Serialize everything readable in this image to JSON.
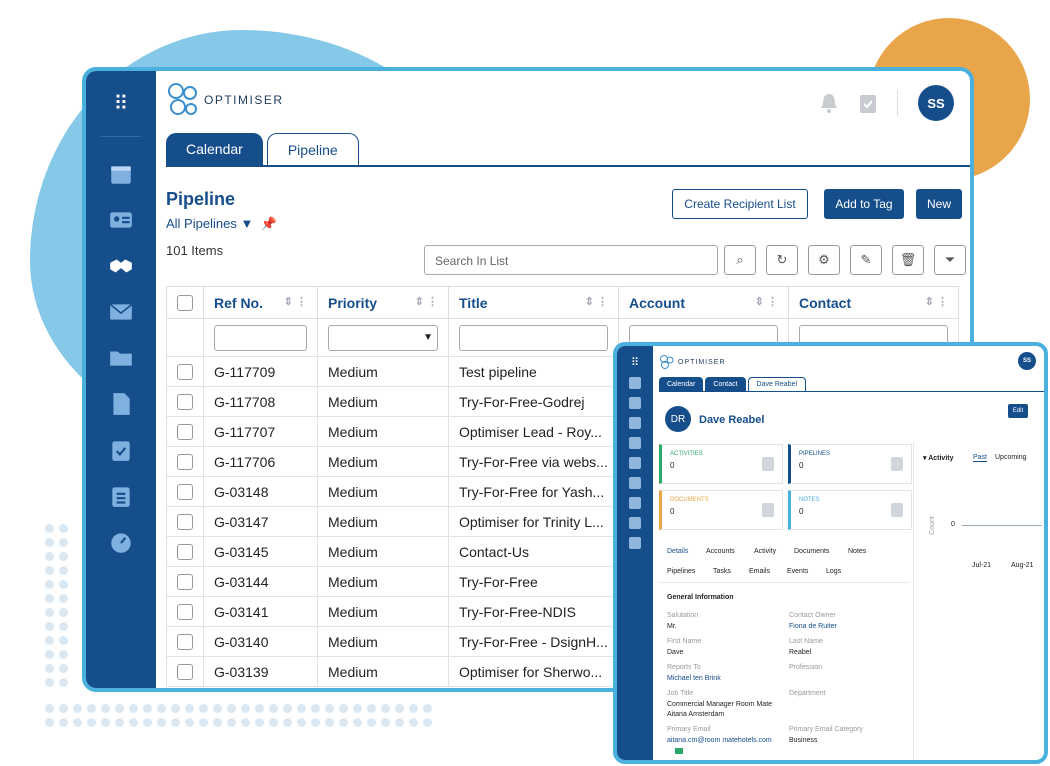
{
  "main": {
    "logo_text": "OPTIMISER",
    "avatar": "SS",
    "tabs": [
      "Calendar",
      "Pipeline"
    ],
    "title": "Pipeline",
    "filter": "All Pipelines",
    "item_count": "101 Items",
    "buttons": {
      "create_recipient": "Create Recipient List",
      "add_to_tag": "Add to Tag",
      "new": "New"
    },
    "search_placeholder": "Search In List",
    "columns": [
      "Ref No.",
      "Priority",
      "Title",
      "Account",
      "Contact"
    ],
    "rows": [
      {
        "ref": "G-117709",
        "priority": "Medium",
        "title": "Test pipeline"
      },
      {
        "ref": "G-117708",
        "priority": "Medium",
        "title": "Try-For-Free-Godrej"
      },
      {
        "ref": "G-117707",
        "priority": "Medium",
        "title": "Optimiser Lead - Roy..."
      },
      {
        "ref": "G-117706",
        "priority": "Medium",
        "title": "Try-For-Free via webs..."
      },
      {
        "ref": "G-03148",
        "priority": "Medium",
        "title": "Try-For-Free for Yash..."
      },
      {
        "ref": "G-03147",
        "priority": "Medium",
        "title": "Optimiser for Trinity L..."
      },
      {
        "ref": "G-03145",
        "priority": "Medium",
        "title": "Contact-Us"
      },
      {
        "ref": "G-03144",
        "priority": "Medium",
        "title": "Try-For-Free"
      },
      {
        "ref": "G-03141",
        "priority": "Medium",
        "title": "Try-For-Free-NDIS"
      },
      {
        "ref": "G-03140",
        "priority": "Medium",
        "title": "Try-For-Free - DsignH..."
      },
      {
        "ref": "G-03139",
        "priority": "Medium",
        "title": "Optimiser for Sherwo..."
      }
    ],
    "accent": "#164e8c"
  },
  "popup": {
    "logo_text": "OPTIMISER",
    "avatar": "SS",
    "tabs": [
      "Calendar",
      "Contact",
      "Dave Reabel"
    ],
    "initials": "DR",
    "name": "Dave Reabel",
    "edit": "Edit",
    "cards": [
      {
        "label": "ACTIVITIES",
        "value": "0",
        "color": "#2ca86b"
      },
      {
        "label": "PIPELINES",
        "value": "0",
        "color": "#164e8c"
      },
      {
        "label": "DOCUMENTS",
        "value": "0",
        "color": "#e8a54a"
      },
      {
        "label": "NOTES",
        "value": "0",
        "color": "#4ab0de"
      }
    ],
    "detail_tabs_1": [
      "Details",
      "Accounts",
      "Activity",
      "Documents",
      "Notes"
    ],
    "detail_tabs_2": [
      "Pipelines",
      "Tasks",
      "Emails",
      "Events",
      "Logs"
    ],
    "section": "General Information",
    "fields": {
      "salutation_l": "Salutation",
      "salutation_v": "Mr.",
      "owner_l": "Contact Owner",
      "owner_v": "Fiona de Ruiter",
      "first_l": "First Name",
      "first_v": "Dave",
      "last_l": "Last Name",
      "last_v": "Reabel",
      "reports_l": "Reports To",
      "reports_v": "Michael ten Brink",
      "profession_l": "Profession",
      "job_l": "Job Title",
      "job_v1": "Commercial Manager Room Mate",
      "job_v2": "Aitana Amsterdam",
      "department_l": "Department",
      "email_l": "Primary Email",
      "email_v": "aitana.cm@room matehotels.com",
      "email_cat_l": "Primary Email Category",
      "email_cat_v": "Business"
    },
    "activity": {
      "title": "Activity",
      "past": "Past",
      "upcoming": "Upcoming",
      "ylabel": "Count",
      "ytick": "0",
      "xticks": [
        "Jul-21",
        "Aug-21"
      ]
    }
  }
}
